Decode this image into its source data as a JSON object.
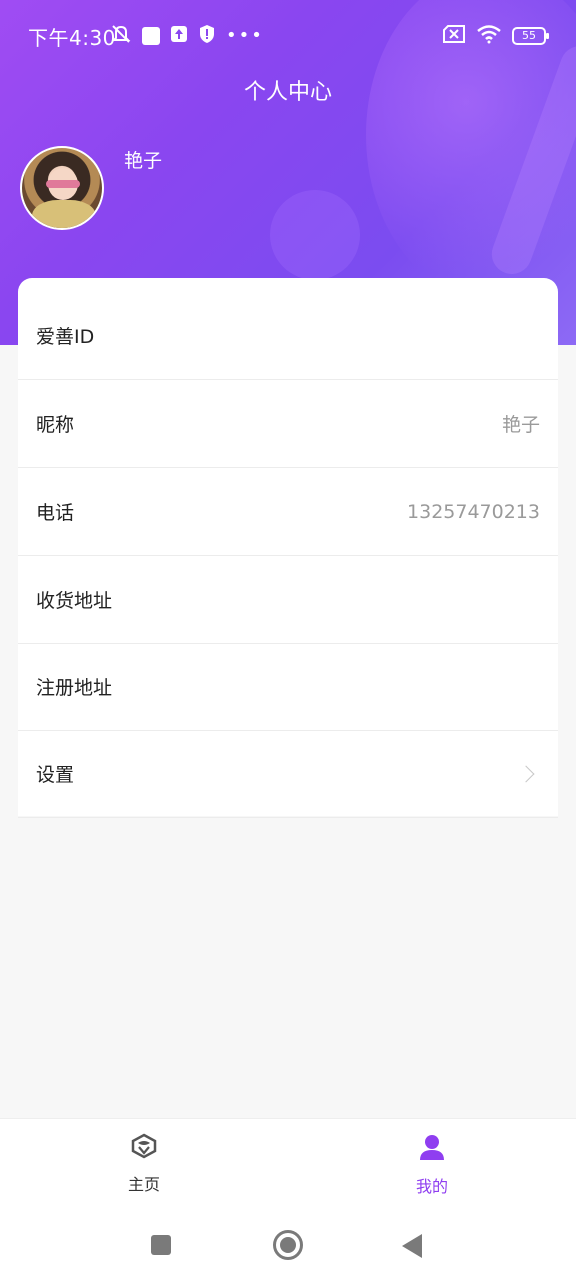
{
  "status_bar": {
    "time": "下午4:30",
    "battery": "55",
    "icons": [
      "mute-icon",
      "notification-icon",
      "upload-icon",
      "shield-icon",
      "more-dots-icon",
      "sim-error-icon",
      "wifi-icon",
      "battery-icon"
    ]
  },
  "header": {
    "title": "个人中心",
    "user_name": "艳子"
  },
  "profile_rows": [
    {
      "label": "爱善ID",
      "value": ""
    },
    {
      "label": "昵称",
      "value": "艳子"
    },
    {
      "label": "电话",
      "value": "13257470213"
    },
    {
      "label": "收货地址",
      "value": ""
    },
    {
      "label": "注册地址",
      "value": ""
    },
    {
      "label": "设置",
      "value": ""
    }
  ],
  "tabbar": {
    "tabs": [
      {
        "label": "主页",
        "icon": "home-logo-icon",
        "active": false
      },
      {
        "label": "我的",
        "icon": "person-icon",
        "active": true
      }
    ]
  },
  "theme": {
    "accent": "#8f3ef0",
    "header_gradient_start": "#a04cf3",
    "header_gradient_end": "#7b4cf0"
  }
}
